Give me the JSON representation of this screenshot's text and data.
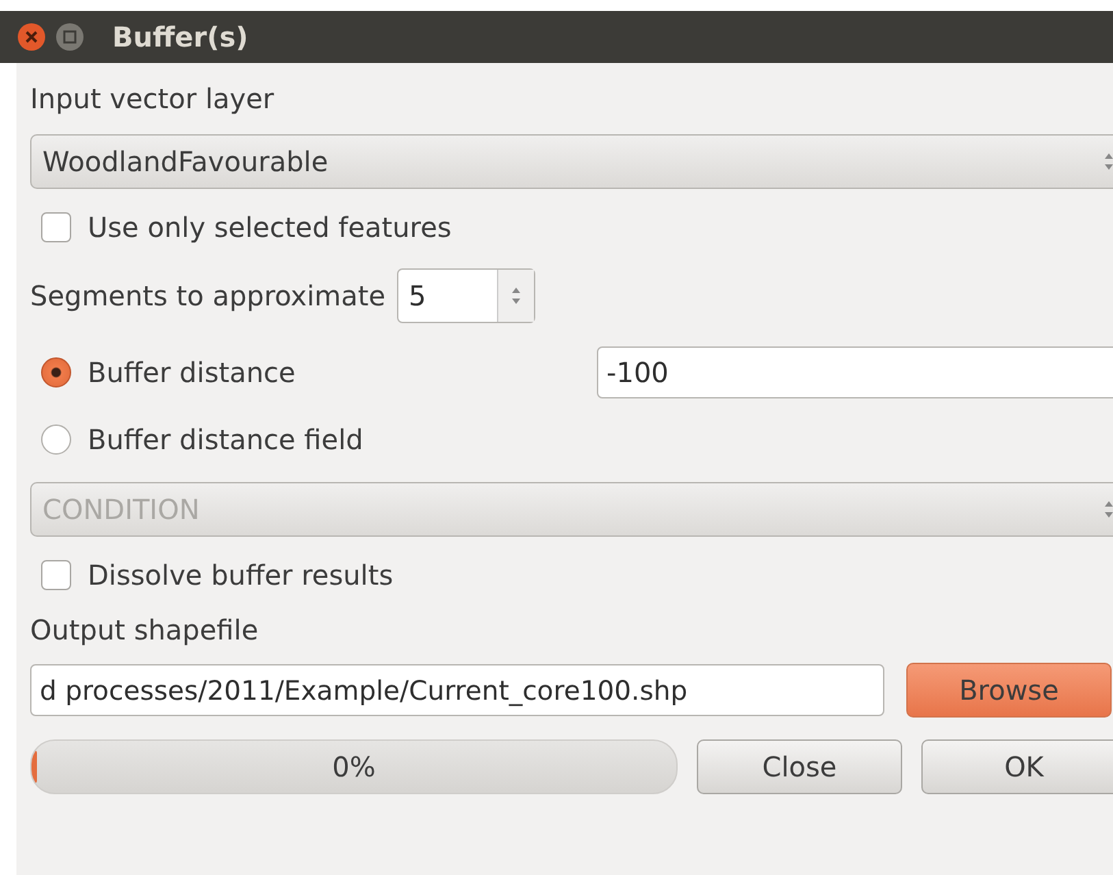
{
  "window": {
    "title": "Buffer(s)"
  },
  "input_layer": {
    "label": "Input vector layer",
    "value": "WoodlandFavourable"
  },
  "selected_only": {
    "label": "Use only selected features",
    "checked": false
  },
  "segments": {
    "label": "Segments to approximate",
    "value": "5"
  },
  "distance_options": [
    {
      "label": "Buffer distance",
      "selected": true,
      "value": "-100"
    },
    {
      "label": "Buffer distance field",
      "selected": false
    }
  ],
  "distance_field": {
    "value": "CONDITION",
    "disabled": true
  },
  "dissolve": {
    "label": "Dissolve buffer results",
    "checked": false
  },
  "output": {
    "label": "Output shapefile",
    "value": "d processes/2011/Example/Current_core100.shp",
    "browse": "Browse"
  },
  "progress": {
    "level": 0,
    "text": "0%"
  },
  "buttons": [
    "Close",
    "OK"
  ]
}
